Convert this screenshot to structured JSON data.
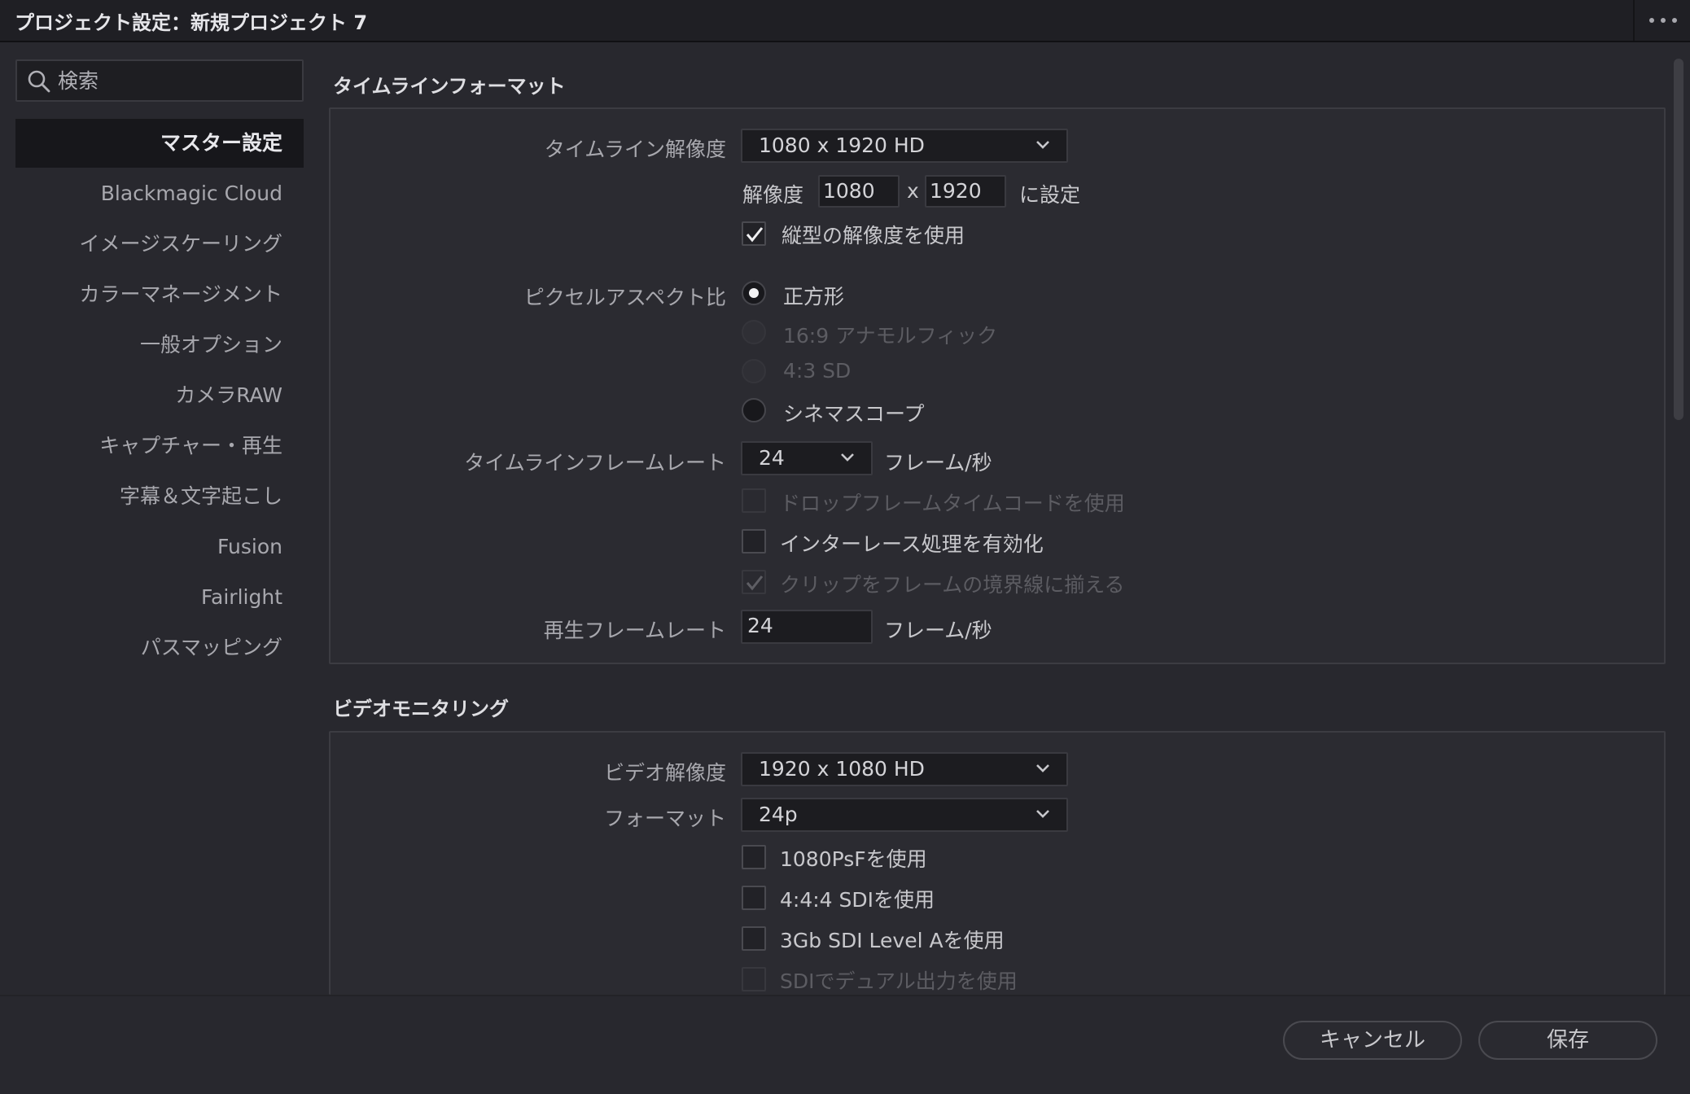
{
  "window": {
    "title": "プロジェクト設定：新規プロジェクト 7",
    "more_icon": "ellipsis-icon"
  },
  "search": {
    "placeholder": "検索",
    "value": ""
  },
  "sidebar": {
    "items": [
      {
        "label": "マスター設定",
        "active": true
      },
      {
        "label": "Blackmagic Cloud"
      },
      {
        "label": "イメージスケーリング"
      },
      {
        "label": "カラーマネージメント"
      },
      {
        "label": "一般オプション"
      },
      {
        "label": "カメラRAW"
      },
      {
        "label": "キャプチャー・再生"
      },
      {
        "label": "字幕＆文字起こし"
      },
      {
        "label": "Fusion"
      },
      {
        "label": "Fairlight"
      },
      {
        "label": "パスマッピング"
      }
    ]
  },
  "timeline_format": {
    "section_title": "タイムラインフォーマット",
    "resolution_label": "タイムライン解像度",
    "resolution_value": "1080 x 1920 HD",
    "custom_res_label": "解像度",
    "width": "1080",
    "x_sep": "x",
    "height": "1920",
    "set_label": "に設定",
    "vertical_label": "縦型の解像度を使用",
    "vertical_checked": true,
    "pixel_aspect_label": "ピクセルアスペクト比",
    "pixel_aspect_options": [
      {
        "label": "正方形",
        "selected": true,
        "enabled": true
      },
      {
        "label": "16:9 アナモルフィック",
        "selected": false,
        "enabled": false
      },
      {
        "label": "4:3 SD",
        "selected": false,
        "enabled": false
      },
      {
        "label": "シネマスコープ",
        "selected": false,
        "enabled": true
      }
    ],
    "frame_rate_label": "タイムラインフレームレート",
    "frame_rate_value": "24",
    "fps_unit": "フレーム/秒",
    "drop_frame_label": "ドロップフレームタイムコードを使用",
    "interlace_label": "インターレース処理を有効化",
    "snap_label": "クリップをフレームの境界線に揃える",
    "playback_rate_label": "再生フレームレート",
    "playback_rate_value": "24",
    "playback_unit": "フレーム/秒"
  },
  "video_monitoring": {
    "section_title": "ビデオモニタリング",
    "resolution_label": "ビデオ解像度",
    "resolution_value": "1920 x 1080 HD",
    "format_label": "フォーマット",
    "format_value": "24p",
    "psf_label": "1080PsFを使用",
    "sdi444_label": "4:4:4 SDIを使用",
    "level_a_label": "3Gb SDI Level Aを使用",
    "dual_label": "SDIでデュアル出力を使用"
  },
  "footer": {
    "cancel_label": "キャンセル",
    "save_label": "保存"
  }
}
